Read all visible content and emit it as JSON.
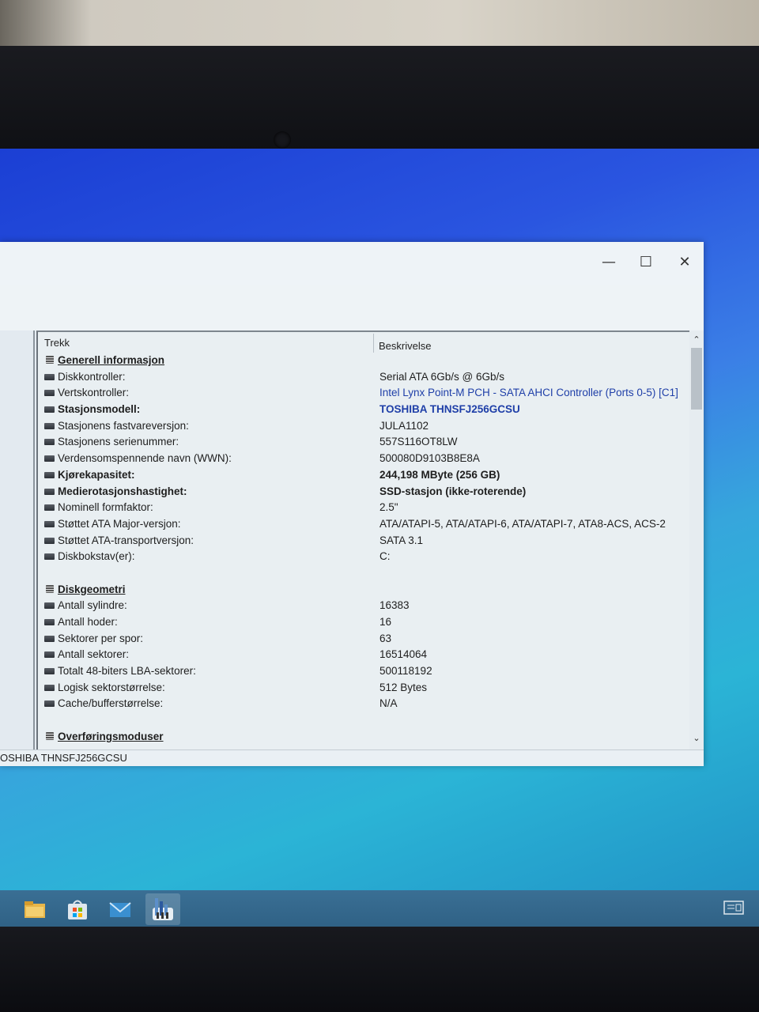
{
  "window": {
    "minimize_glyph": "—",
    "maximize_glyph": "☐",
    "close_glyph": "✕"
  },
  "table": {
    "col_feature": "Trekk",
    "col_description": "Beskrivelse",
    "rows": [
      {
        "kind": "section",
        "label": "Generell informasjon",
        "value": ""
      },
      {
        "kind": "item",
        "label": "Diskkontroller:",
        "value": "Serial ATA 6Gb/s @ 6Gb/s"
      },
      {
        "kind": "item",
        "label": "Vertskontroller:",
        "value": "Intel Lynx Point-M PCH - SATA AHCI Controller (Ports 0-5) [C1]",
        "link": true
      },
      {
        "kind": "bold",
        "label": "Stasjonsmodell:",
        "value": "TOSHIBA THNSFJ256GCSU",
        "link": true
      },
      {
        "kind": "item",
        "label": "Stasjonens fastvareversjon:",
        "value": "JULA1102"
      },
      {
        "kind": "item",
        "label": "Stasjonens serienummer:",
        "value": "557S116OT8LW"
      },
      {
        "kind": "item",
        "label": "Verdensomspennende navn (WWN):",
        "value": "500080D9103B8E8A"
      },
      {
        "kind": "bold",
        "label": "Kjørekapasitet:",
        "value": "244,198 MByte (256 GB)"
      },
      {
        "kind": "bold",
        "label": "Medierotasjonshastighet:",
        "value": "SSD-stasjon (ikke-roterende)"
      },
      {
        "kind": "item",
        "label": "Nominell formfaktor:",
        "value": "2.5\""
      },
      {
        "kind": "item",
        "label": "Støttet ATA Major-versjon:",
        "value": "ATA/ATAPI-5, ATA/ATAPI-6, ATA/ATAPI-7, ATA8-ACS, ACS-2"
      },
      {
        "kind": "item",
        "label": "Støttet ATA-transportversjon:",
        "value": "SATA 3.1"
      },
      {
        "kind": "item",
        "label": "Diskbokstav(er):",
        "value": "C:"
      },
      {
        "kind": "blank",
        "label": "",
        "value": ""
      },
      {
        "kind": "section",
        "label": "Diskgeometri",
        "value": ""
      },
      {
        "kind": "item",
        "label": "Antall sylindre:",
        "value": "16383"
      },
      {
        "kind": "item",
        "label": "Antall hoder:",
        "value": "16"
      },
      {
        "kind": "item",
        "label": "Sektorer per spor:",
        "value": "63"
      },
      {
        "kind": "item",
        "label": "Antall sektorer:",
        "value": "16514064"
      },
      {
        "kind": "item",
        "label": "Totalt 48-biters LBA-sektorer:",
        "value": "500118192"
      },
      {
        "kind": "item",
        "label": "Logisk sektorstørrelse:",
        "value": "512 Bytes"
      },
      {
        "kind": "item",
        "label": "Cache/bufferstørrelse:",
        "value": "N/A"
      },
      {
        "kind": "blank",
        "label": "",
        "value": ""
      },
      {
        "kind": "section",
        "label": "Overføringsmoduser",
        "value": ""
      }
    ]
  },
  "statusbar": {
    "text": "OSHIBA THNSFJ256GCSU"
  },
  "scroll": {
    "up_glyph": "⌃",
    "down_glyph": "⌄"
  },
  "taskbar": {
    "icons": [
      "file-explorer-icon",
      "store-icon",
      "mail-icon",
      "benchmark-app-icon"
    ]
  }
}
